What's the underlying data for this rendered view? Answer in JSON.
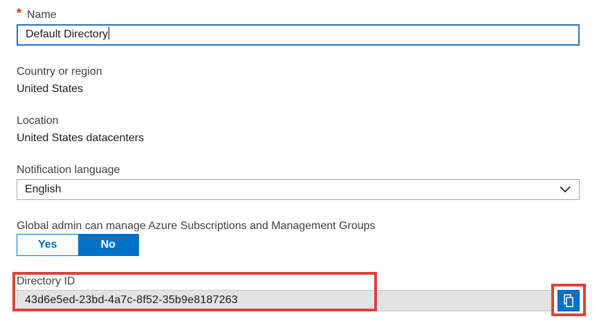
{
  "name": {
    "required_marker": "*",
    "label": "Name",
    "value": "Default Directory"
  },
  "country": {
    "label": "Country or region",
    "value": "United States"
  },
  "location": {
    "label": "Location",
    "value": "United States datacenters"
  },
  "notification_language": {
    "label": "Notification language",
    "selected": "English"
  },
  "global_admin": {
    "label": "Global admin can manage Azure Subscriptions and Management Groups",
    "options": [
      "Yes",
      "No"
    ],
    "selected": "No"
  },
  "directory_id": {
    "label": "Directory ID",
    "value": "43d6e5ed-23bd-4a7c-8f52-35b9e8187263",
    "copy_icon": "copy-icon"
  },
  "colors": {
    "accent": "#0072c6",
    "highlight": "#e0403a",
    "required": "#d02e00"
  }
}
